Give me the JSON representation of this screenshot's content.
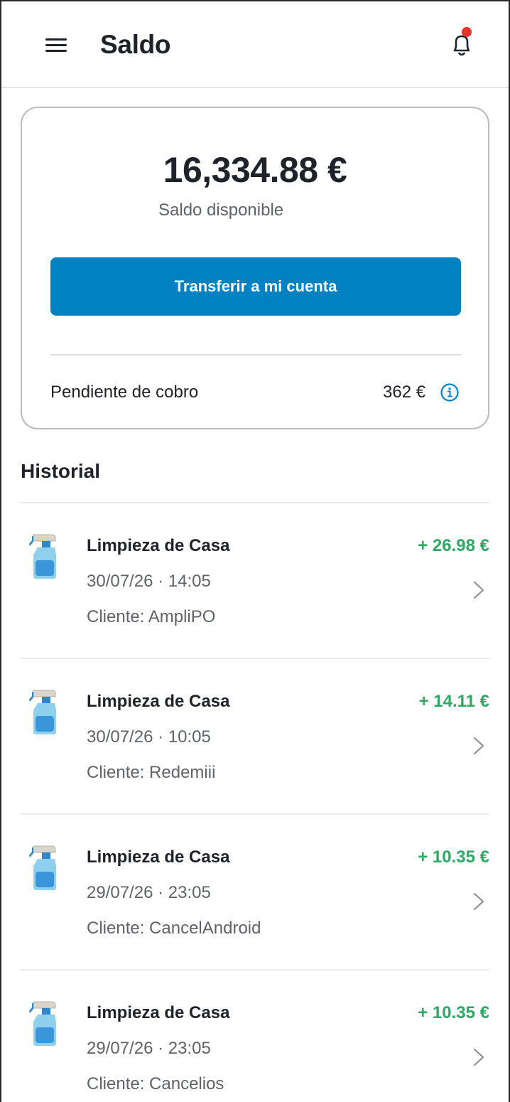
{
  "header": {
    "title": "Saldo",
    "menu_icon": "hamburger-menu-icon",
    "bell_icon": "bell-icon",
    "notification_dot_color": "#e8322b"
  },
  "balance": {
    "amount": "16,334.88 €",
    "label": "Saldo disponible",
    "transfer_button": "Transferir a mi cuenta",
    "pending_label": "Pendiente de cobro",
    "pending_value": "362 €",
    "info_icon": "info-icon",
    "accent_color": "#0081c2"
  },
  "history": {
    "title": "Historial",
    "item_icon": "spray-bottle-icon",
    "amount_color": "#2fa865",
    "items": [
      {
        "title": "Limpieza de Casa",
        "date": "30/07/26 · 14:05",
        "client": "Cliente: AmpliPO",
        "amount": "+ 26.98 €"
      },
      {
        "title": "Limpieza de Casa",
        "date": "30/07/26 · 10:05",
        "client": "Cliente: Redemiii",
        "amount": "+ 14.11 €"
      },
      {
        "title": "Limpieza de Casa",
        "date": "29/07/26 · 23:05",
        "client": "Cliente: CancelAndroid",
        "amount": "+ 10.35 €"
      },
      {
        "title": "Limpieza de Casa",
        "date": "29/07/26 · 23:05",
        "client": "Cliente: Cancelios",
        "amount": "+ 10.35 €"
      }
    ]
  }
}
